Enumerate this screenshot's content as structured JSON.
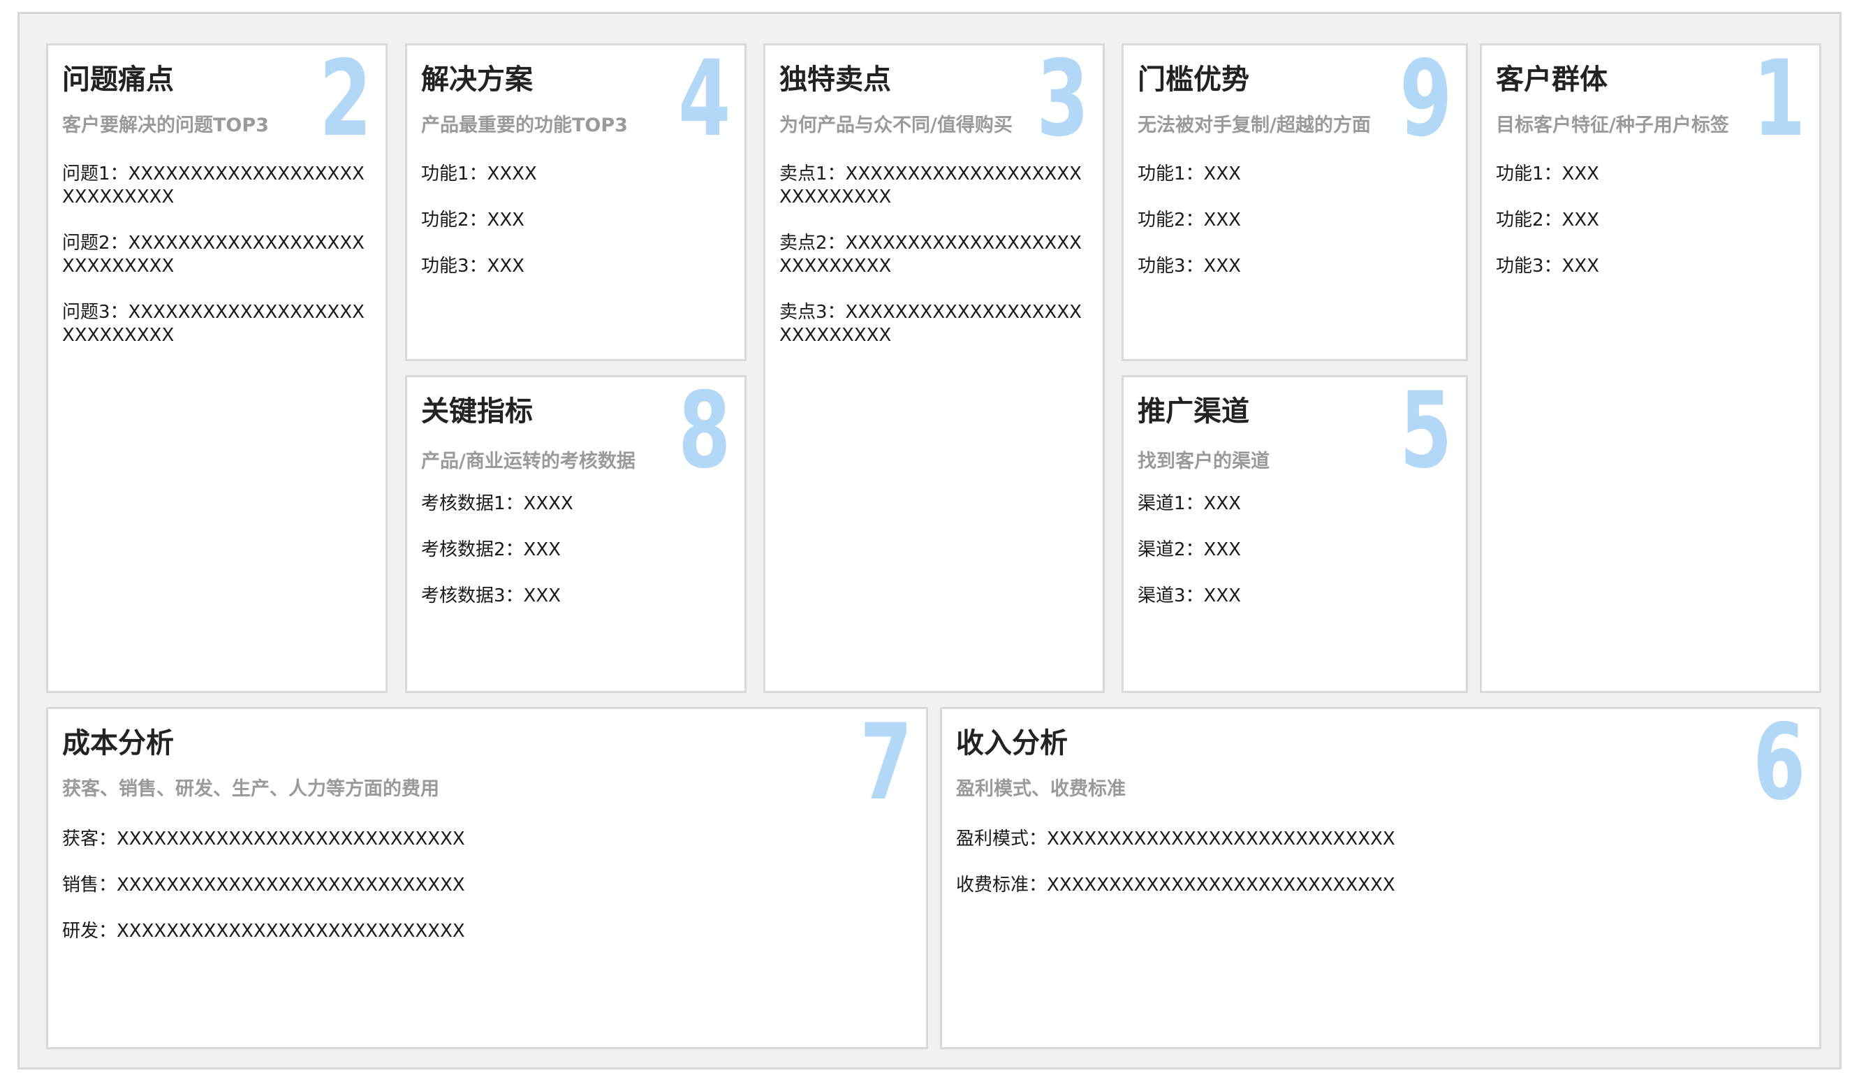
{
  "canvas": {
    "cards": [
      {
        "id": "problem",
        "title": "问题痛点",
        "subtitle": "客户要解决的问题TOP3",
        "number": "2",
        "items": [
          "问题1：XXXXXXXXXXXXXXXXXXXXXXXXXXXX",
          "问题2：XXXXXXXXXXXXXXXXXXXXXXXXXXXX",
          "问题3：XXXXXXXXXXXXXXXXXXXXXXXXXXXX"
        ]
      },
      {
        "id": "solution",
        "title": "解决方案",
        "subtitle": "产品最重要的功能TOP3",
        "number": "4",
        "items": [
          "功能1：XXXX",
          "功能2：XXX",
          "功能3：XXX"
        ]
      },
      {
        "id": "usp",
        "title": "独特卖点",
        "subtitle": "为何产品与众不同/值得购买",
        "number": "3",
        "items": [
          "卖点1：XXXXXXXXXXXXXXXXXXXXXXXXXXXX",
          "卖点2：XXXXXXXXXXXXXXXXXXXXXXXXXXXX",
          "卖点3：XXXXXXXXXXXXXXXXXXXXXXXXXXXX"
        ]
      },
      {
        "id": "advantage",
        "title": "门槛优势",
        "subtitle": "无法被对手复制/超越的方面",
        "number": "9",
        "items": [
          "功能1：XXX",
          "功能2：XXX",
          "功能3：XXX"
        ]
      },
      {
        "id": "segments",
        "title": "客户群体",
        "subtitle": "目标客户特征/种子用户标签",
        "number": "1",
        "items": [
          "功能1：XXX",
          "功能2：XXX",
          "功能3：XXX"
        ]
      },
      {
        "id": "metrics",
        "title": "关键指标",
        "subtitle": "产品/商业运转的考核数据",
        "number": "8",
        "items": [
          "考核数据1：XXXX",
          "考核数据2：XXX",
          "考核数据3：XXX"
        ]
      },
      {
        "id": "channels",
        "title": "推广渠道",
        "subtitle": "找到客户的渠道",
        "number": "5",
        "items": [
          "渠道1：XXX",
          "渠道2：XXX",
          "渠道3：XXX"
        ]
      },
      {
        "id": "cost",
        "title": "成本分析",
        "subtitle": "获客、销售、研发、生产、人力等方面的费用",
        "number": "7",
        "items": [
          "获客：XXXXXXXXXXXXXXXXXXXXXXXXXXXX",
          "销售：XXXXXXXXXXXXXXXXXXXXXXXXXXXX",
          "研发：XXXXXXXXXXXXXXXXXXXXXXXXXXXX"
        ]
      },
      {
        "id": "revenue",
        "title": "收入分析",
        "subtitle": "盈利模式、收费标准",
        "number": "6",
        "items": [
          "盈利模式：XXXXXXXXXXXXXXXXXXXXXXXXXXXX",
          "收费标准：XXXXXXXXXXXXXXXXXXXXXXXXXXXX"
        ]
      }
    ]
  }
}
